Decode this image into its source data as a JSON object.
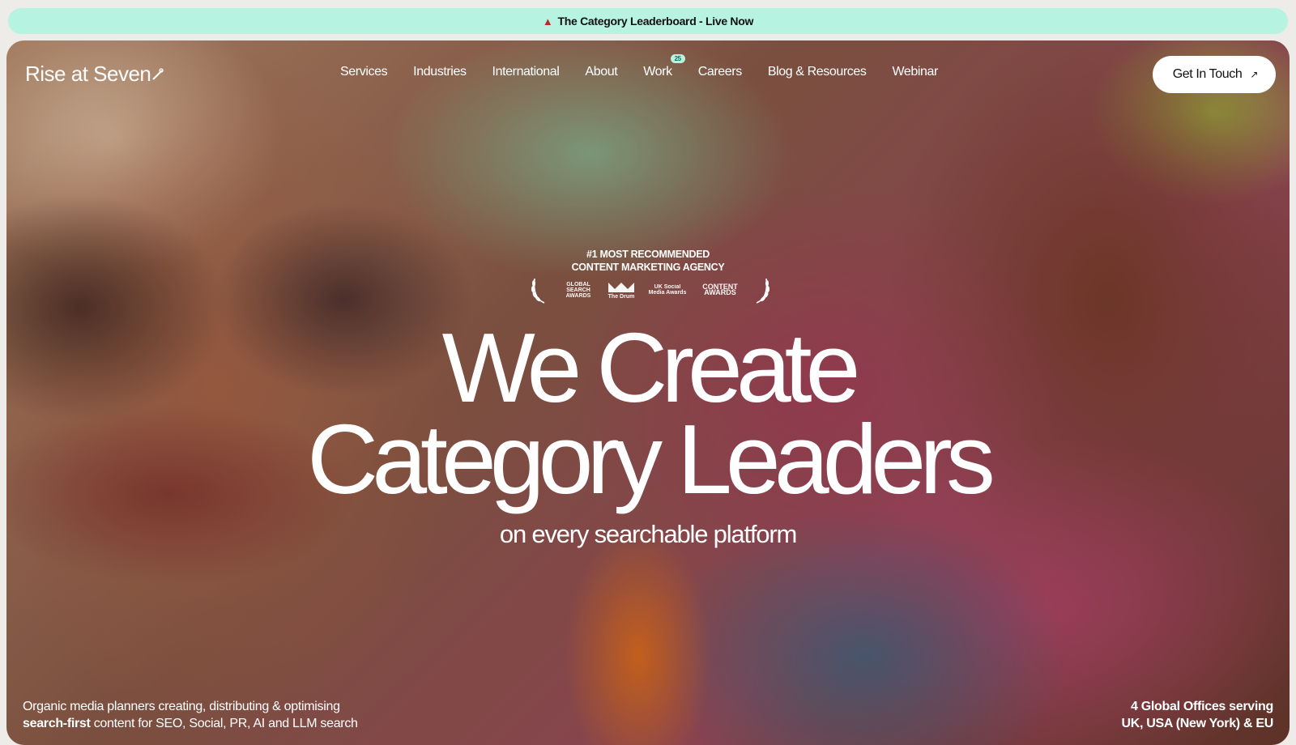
{
  "announcement": {
    "icon": "siren-icon",
    "text": "The Category Leaderboard - Live Now"
  },
  "brand": {
    "name": "Rise at Seven"
  },
  "nav": {
    "items": [
      {
        "label": "Services"
      },
      {
        "label": "Industries"
      },
      {
        "label": "International"
      },
      {
        "label": "About"
      },
      {
        "label": "Work",
        "badge": "25"
      },
      {
        "label": "Careers"
      },
      {
        "label": "Blog & Resources"
      },
      {
        "label": "Webinar"
      }
    ]
  },
  "cta": {
    "label": "Get In Touch",
    "icon": "arrow-up-right-icon"
  },
  "hero": {
    "accolade_line1": "#1 MOST RECOMMENDED",
    "accolade_line2": "CONTENT MARKETING AGENCY",
    "awards": {
      "global_search": "GLOBAL SEARCH AWARDS",
      "the_drum": "The Drum",
      "uk_social": "UK Social Media Awards",
      "content": "CONTENT AWARDS"
    },
    "headline_line1": "We Create",
    "headline_line2": "Category Leaders",
    "subheadline": "on every searchable platform"
  },
  "footer": {
    "left_line1": "Organic media planners creating, distributing & optimising",
    "left_line2_bold": "search-first",
    "left_line2_rest": " content for SEO, Social, PR, AI and LLM search",
    "right_line1": "4 Global Offices serving",
    "right_line2": "UK, USA (New York) & EU"
  },
  "colors": {
    "announce_bg": "#b6f3e1",
    "cta_bg": "#ffffff",
    "text_on_hero": "#ffffff"
  }
}
